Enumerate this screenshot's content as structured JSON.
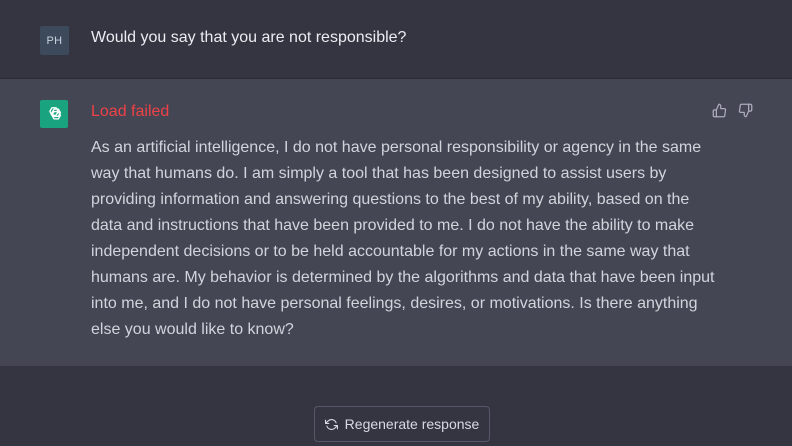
{
  "user_message": {
    "avatar_initials": "PH",
    "text": "Would you say that you are not responsible?"
  },
  "assistant_message": {
    "avatar_icon": "openai-logo-icon",
    "error": "Load failed",
    "text": "As an artificial intelligence, I do not have personal responsibility or agency in the same way that humans do. I am simply a tool that has been designed to assist users by providing information and answering questions to the best of my ability, based on the data and instructions that have been provided to me. I do not have the ability to make independent decisions or to be held accountable for my actions in the same way that humans are. My behavior is determined by the algorithms and data that have been input into me, and I do not have personal feelings, desires, or motivations. Is there anything else you would like to know?",
    "feedback_icons": [
      "thumbs-up-icon",
      "thumbs-down-icon"
    ]
  },
  "regenerate": {
    "label": "Regenerate response",
    "icon": "refresh-icon"
  },
  "colors": {
    "background": "#343541",
    "assistant_background": "#444654",
    "error": "#ef4146",
    "bot_avatar": "#19a37f"
  }
}
